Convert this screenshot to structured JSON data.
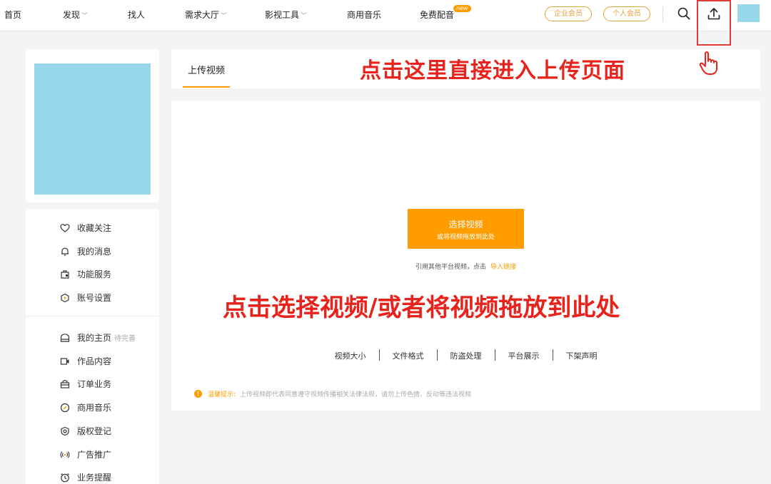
{
  "nav": {
    "home": "首页",
    "discover": "发现",
    "find_people": "找人",
    "demand_hall": "需求大厅",
    "video_tools": "影视工具",
    "commercial_music": "商用音乐",
    "free_dubbing": "免费配音",
    "new_badge": "new",
    "enterprise_vip": "企业会员",
    "personal_vip": "个人会员",
    "search_icon": "search-icon",
    "upload_icon": "upload-icon"
  },
  "sidebar": {
    "group1": [
      {
        "label": "收藏关注",
        "icon": "heart-icon"
      },
      {
        "label": "我的消息",
        "icon": "bell-icon"
      },
      {
        "label": "功能服务",
        "icon": "service-icon"
      },
      {
        "label": "账号设置",
        "icon": "settings-icon"
      }
    ],
    "group2": [
      {
        "label": "我的主页",
        "icon": "home-icon",
        "note": "待完善"
      },
      {
        "label": "作品内容",
        "icon": "video-icon"
      },
      {
        "label": "订单业务",
        "icon": "order-icon"
      },
      {
        "label": "商用音乐",
        "icon": "music-icon"
      },
      {
        "label": "版权登记",
        "icon": "copyright-icon"
      },
      {
        "label": "广告推广",
        "icon": "broadcast-icon"
      },
      {
        "label": "业务提醒",
        "icon": "alarm-icon"
      }
    ]
  },
  "main": {
    "tab_upload": "上传视频",
    "annotation_top": "点击这里直接进入上传页面",
    "select_video": "选择视频",
    "drag_hint": "或将视频拖放到此处",
    "import_text": "引用其他平台视频，点击",
    "import_link": "导入链接",
    "annotation_mid": "点击选择视频/或者将视频拖放到此处",
    "specs": [
      "视频大小",
      "文件格式",
      "防盗处理",
      "平台展示",
      "下架声明"
    ],
    "tip_label": "温馨提示:",
    "tip_text": "上传视频即代表同意遵守视频传播相关法律法规，请勿上传色情、反动等违法视频"
  },
  "colors": {
    "accent": "#ff9c00",
    "annotation": "#e8231c",
    "avatar": "#98d8ea"
  }
}
